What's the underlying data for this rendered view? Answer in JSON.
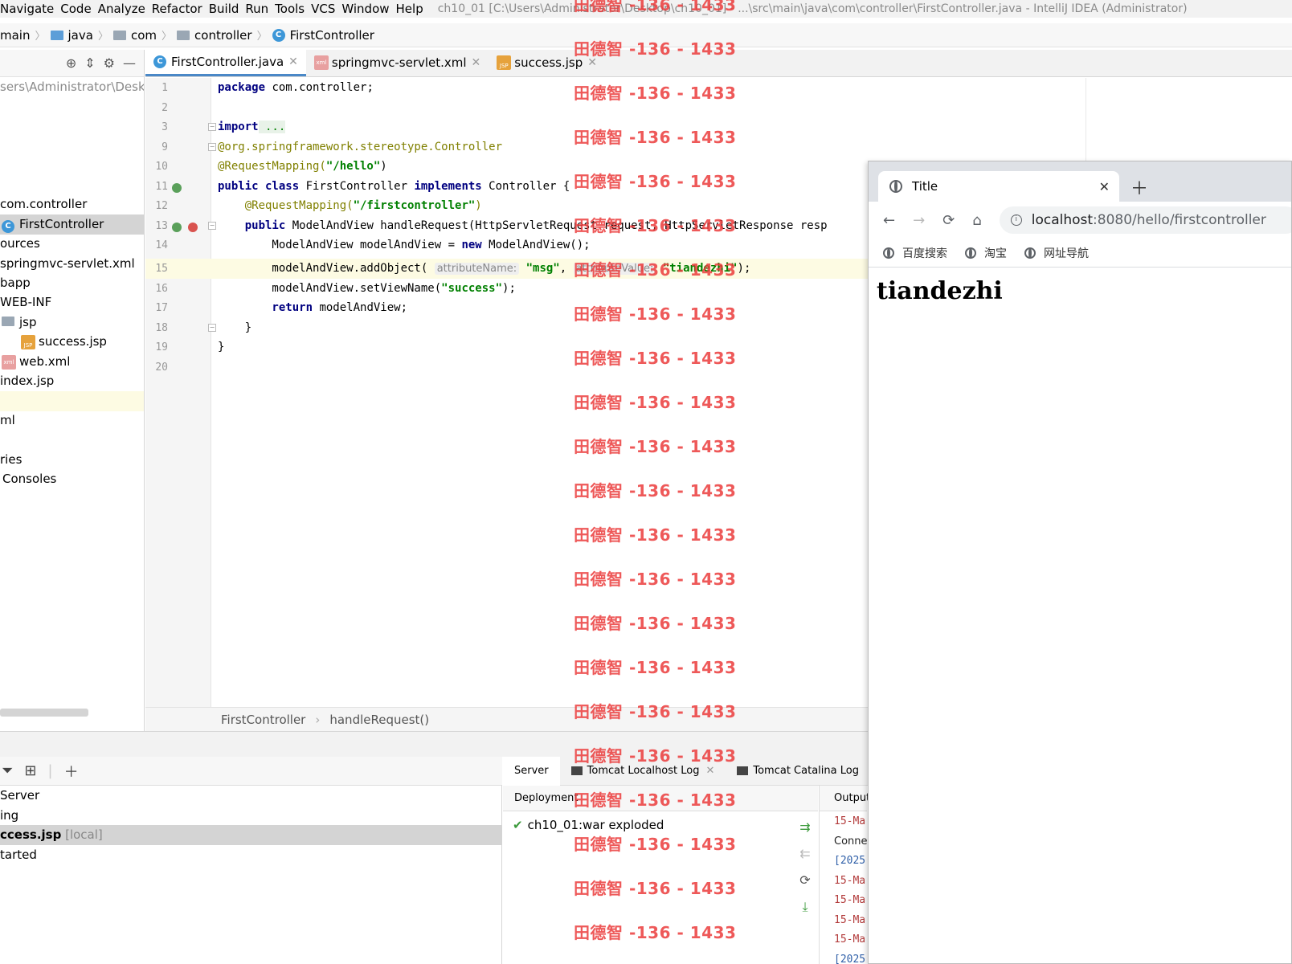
{
  "menubar": {
    "items": [
      "Navigate",
      "Code",
      "Analyze",
      "Refactor",
      "Build",
      "Run",
      "Tools",
      "VCS",
      "Window",
      "Help"
    ],
    "window_title": "ch10_01 [C:\\Users\\Administrator\\Desktop\\ch10_01] - ...\\src\\main\\java\\com\\controller\\FirstController.java - IntelliJ IDEA (Administrator)"
  },
  "navbar": {
    "crumbs": [
      "main",
      "java",
      "com",
      "controller",
      "FirstController"
    ]
  },
  "project": {
    "rows": [
      {
        "text": "sers\\Administrator\\Deskt",
        "style": "muted"
      },
      {
        "text": "com.controller"
      },
      {
        "text": "FirstController",
        "style": "sel"
      },
      {
        "text": "ources"
      },
      {
        "text": "springmvc-servlet.xml"
      },
      {
        "text": "bapp"
      },
      {
        "text": "WEB-INF"
      },
      {
        "text": "jsp"
      },
      {
        "text": "success.jsp"
      },
      {
        "text": "web.xml"
      },
      {
        "text": "index.jsp"
      },
      {
        "text": "ml"
      },
      {
        "text": "ries"
      },
      {
        "text": "Consoles"
      }
    ]
  },
  "tabs": [
    {
      "label": "FirstController.java",
      "active": true
    },
    {
      "label": "springmvc-servlet.xml",
      "active": false
    },
    {
      "label": "success.jsp",
      "active": false
    }
  ],
  "editor": {
    "line_numbers": [
      "1",
      "2",
      "3",
      "9",
      "10",
      "11",
      "12",
      "13",
      "14",
      "15",
      "16",
      "17",
      "18",
      "19",
      "20"
    ],
    "lines": {
      "l1_kw": "package",
      "l1_rest": " com.controller;",
      "l3_kw": "import",
      "l3_rest": " ...",
      "l9": "@org.springframework.stereotype.Controller",
      "l10_ann": "@RequestMapping(",
      "l10_str": "\"/hello\"",
      "l10_end": ")",
      "l11_kw1": "public class",
      "l11_name": " FirstController ",
      "l11_kw2": "implements",
      "l11_rest": " Controller {",
      "l12_ann": "    @RequestMapping(",
      "l12_str": "\"/firstcontroller\"",
      "l12_end": ")",
      "l13_kw": "    public",
      "l13_rest": " ModelAndView handleRequest(HttpServletRequest request, HttpServletResponse resp",
      "l14_a": "        ModelAndView modelAndView = ",
      "l14_kw": "new",
      "l14_b": " ModelAndView();",
      "l15_a": "        modelAndView.addObject( ",
      "l15_hint1": "attributeName:",
      "l15_str1": " \"msg\"",
      "l15_b": ", ",
      "l15_hint2": "attributeValue:",
      "l15_str2": " \"tiandezhi\"",
      "l15_c": ");",
      "l16_a": "        modelAndView.setViewName(",
      "l16_str": "\"success\"",
      "l16_b": ");",
      "l17_kw": "        return",
      "l17_rest": " modelAndView;",
      "l18": "    }",
      "l19": "}"
    }
  },
  "editor_breadcrumb": [
    "FirstController",
    "handleRequest()"
  ],
  "run_panel": {
    "rows": [
      {
        "text": "Server"
      },
      {
        "text": "ing"
      },
      {
        "text": "ccess.jsp",
        "suffix": "[local]",
        "sel": true
      },
      {
        "text": "tarted"
      }
    ]
  },
  "services": {
    "tabs": [
      "Server",
      "Tomcat Localhost Log",
      "Tomcat Catalina Log"
    ],
    "deployment_header": "Deployment",
    "deployment_item": "ch10_01:war exploded",
    "output_header": "Output",
    "output_lines": [
      "15-Ma",
      "Conne",
      "[2025",
      "15-Ma",
      "15-Ma",
      "15-Ma",
      "15-Ma",
      "[2025"
    ]
  },
  "browser": {
    "tab_title": "Title",
    "url_host": "localhost",
    "url_path": ":8080/hello/firstcontroller",
    "bookmarks": [
      "百度搜索",
      "淘宝",
      "网址导航"
    ],
    "page_heading": "tiandezhi"
  },
  "watermark": "田德智 -136 - 1433",
  "colors": {
    "keyword": "#000080",
    "annotation": "#808000",
    "string": "#008000",
    "watermark": "#eb3c3c",
    "active_tab_underline": "#4a88c7"
  }
}
